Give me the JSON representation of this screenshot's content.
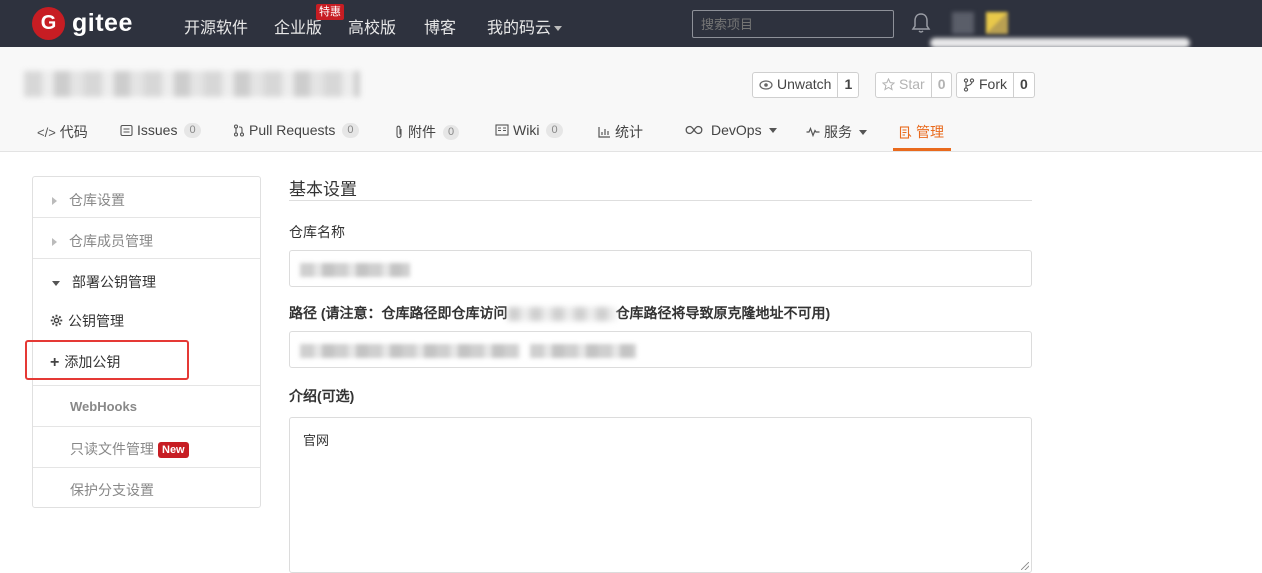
{
  "header": {
    "logo_text": "gitee",
    "nav": [
      "开源软件",
      "企业版",
      "高校版",
      "博客",
      "我的码云"
    ],
    "hot_badge": "特惠",
    "search_placeholder": "搜索项目"
  },
  "repo": {
    "watch": {
      "label": "Unwatch",
      "count": "1"
    },
    "star": {
      "label": "Star",
      "count": "0"
    },
    "fork": {
      "label": "Fork",
      "count": "0"
    },
    "tabs": [
      {
        "label": "代码",
        "icon": "code-icon"
      },
      {
        "label": "Issues",
        "count": "0",
        "icon": "issues-icon"
      },
      {
        "label": "Pull Requests",
        "count": "0",
        "icon": "pull-request-icon"
      },
      {
        "label": "附件",
        "count": "0",
        "icon": "attachment-icon"
      },
      {
        "label": "Wiki",
        "count": "0",
        "icon": "wiki-icon"
      },
      {
        "label": "统计",
        "icon": "chart-icon"
      },
      {
        "label": "DevOps",
        "icon": "devops-icon"
      },
      {
        "label": "服务",
        "icon": "pulse-icon"
      },
      {
        "label": "管理",
        "icon": "manage-icon",
        "active": true
      }
    ]
  },
  "sidebar": {
    "items": [
      {
        "label": "仓库设置"
      },
      {
        "label": "仓库成员管理"
      },
      {
        "label": "部署公钥管理"
      },
      {
        "label": "公钥管理"
      },
      {
        "label": "添加公钥"
      },
      {
        "label": "WebHooks"
      },
      {
        "label": "只读文件管理",
        "badge": "New"
      },
      {
        "label": "保护分支设置"
      }
    ]
  },
  "form": {
    "title": "基本设置",
    "name_label": "仓库名称",
    "path_label_a": "路径 (请注意：仓库路径即仓库访问",
    "path_label_b": "仓库路径将导致原克隆地址不可用)",
    "intro_label": "介绍(可选)",
    "intro_value": "官网"
  },
  "colors": {
    "topbar": "#2e323e",
    "brand": "#c71d23",
    "accent": "#e96a1d",
    "highlight": "#e53935"
  }
}
